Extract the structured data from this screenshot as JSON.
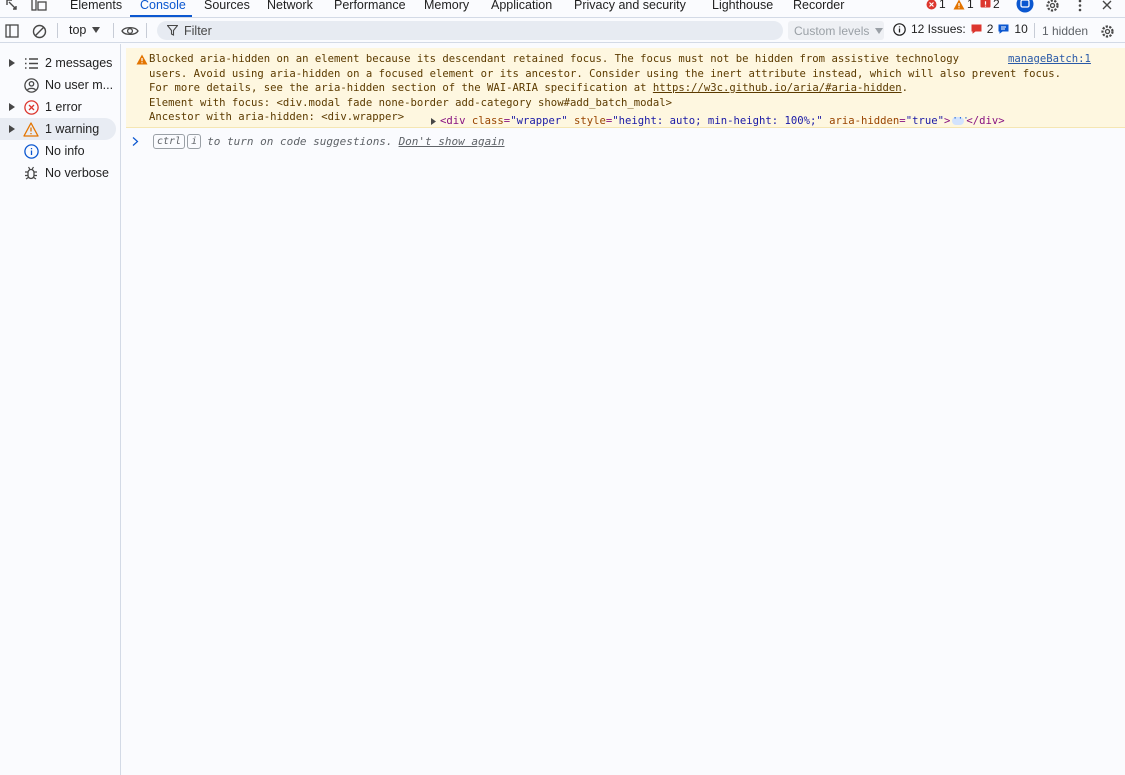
{
  "tabs": [
    "Elements",
    "Console",
    "Sources",
    "Network",
    "Performance",
    "Memory",
    "Application",
    "Privacy and security",
    "Lighthouse",
    "Recorder"
  ],
  "active_tab": "Console",
  "top_status": {
    "errors": "1",
    "warnings": "1",
    "issues": "2"
  },
  "toolbar": {
    "context": "top",
    "filter_placeholder": "Filter",
    "levels": "Custom levels",
    "issues_label": "12 Issues:",
    "issues_errors": "2",
    "issues_info": "10",
    "hidden": "1 hidden"
  },
  "sidebar": {
    "items": [
      {
        "label": "2 messages",
        "icon": "list-icon"
      },
      {
        "label": "No user m...",
        "icon": "user-icon"
      },
      {
        "label": "1 error",
        "icon": "error-icon"
      },
      {
        "label": "1 warning",
        "icon": "warning-icon"
      },
      {
        "label": "No info",
        "icon": "info-icon"
      },
      {
        "label": "No verbose",
        "icon": "bug-icon"
      }
    ]
  },
  "message": {
    "line1": "Blocked aria-hidden on an element because its descendant retained focus. The focus must not be hidden from assistive technology",
    "line2": "users. Avoid using aria-hidden on a focused element or its ancestor. Consider using the inert attribute instead, which will also prevent focus.",
    "line3_prefix": "For more details, see the aria-hidden section of the WAI-ARIA specification at ",
    "line3_link": "https://w3c.github.io/aria/#aria-hidden",
    "line3_suffix": ".",
    "line4": "Element with focus: <div.modal fade none-border add-category show#add_batch_modal>",
    "line5": "Ancestor with aria-hidden: <div.wrapper>",
    "source": "manageBatch:1",
    "node": {
      "open": "<div",
      "attr1": " class",
      "val1": "\"wrapper\"",
      "attr2": " style",
      "val2": "\"height: auto; min-height: 100%;\"",
      "attr3": " aria-hidden",
      "val3": "\"true\"",
      "open_end": ">",
      "close": "</div>"
    }
  },
  "prompt": {
    "key1": "ctrl",
    "key2": "i",
    "text": "to turn on code suggestions.",
    "dismiss": "Don't show again"
  },
  "colors": {
    "accent": "#0b57d0",
    "warning_bg": "#fef7e0",
    "error": "#dc362e",
    "warning": "#e37400"
  }
}
